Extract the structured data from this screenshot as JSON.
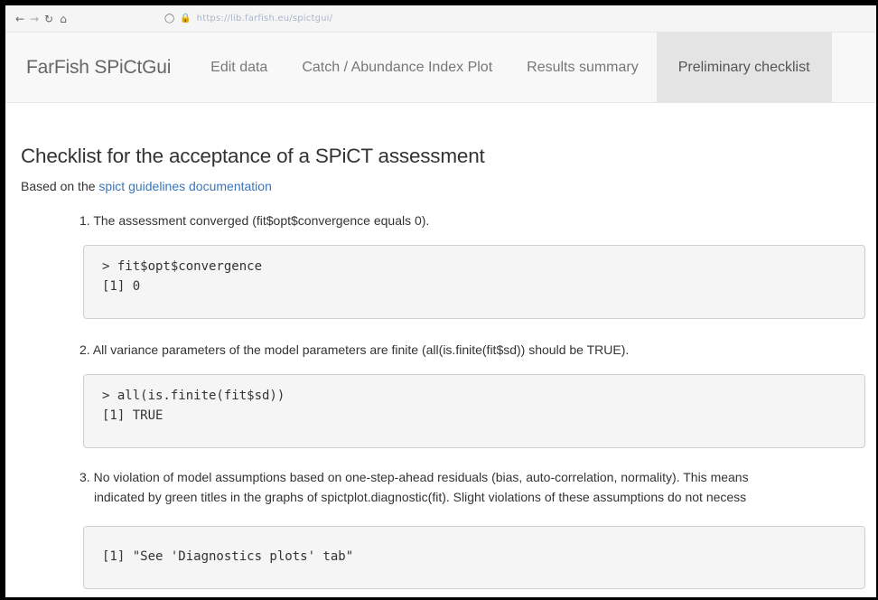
{
  "browser": {
    "url": "https://lib.farfish.eu/spictgui/"
  },
  "navbar": {
    "brand": "FarFish SPiCtGui",
    "items": [
      {
        "label": "Edit data"
      },
      {
        "label": "Catch / Abundance Index Plot"
      },
      {
        "label": "Results summary"
      },
      {
        "label": "Preliminary checklist",
        "active": true
      }
    ]
  },
  "page": {
    "title": "Checklist for the acceptance of a SPiCT assessment",
    "intro_prefix": "Based on the",
    "intro_link": "spict guidelines documentation"
  },
  "checklist": [
    {
      "number": "1.",
      "text": "The assessment converged (fit$opt$convergence equals 0).",
      "code": [
        "> fit$opt$convergence",
        "[1] 0"
      ]
    },
    {
      "number": "2.",
      "text": "All variance parameters of the model parameters are finite (all(is.finite(fit$sd)) should be TRUE).",
      "code": [
        "> all(is.finite(fit$sd))",
        "[1] TRUE"
      ]
    },
    {
      "number": "3.",
      "text_line1": "No violation of model assumptions based on one-step-ahead residuals (bias, auto-correlation, normality). This means",
      "text_line2": "indicated by green titles in the graphs of spictplot.diagnostic(fit). Slight violations of these assumptions do not necess",
      "code": [
        "[1] \"See 'Diagnostics plots' tab\""
      ]
    }
  ],
  "colors": {
    "link": "#3a76b8",
    "navbar_bg": "#f8f8f8",
    "active_tab_bg": "#e4e4e4",
    "code_bg": "#f5f5f5"
  }
}
